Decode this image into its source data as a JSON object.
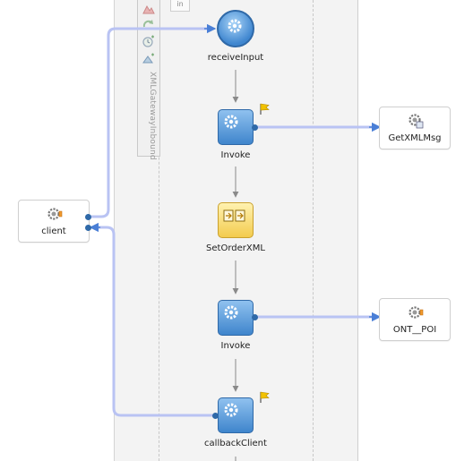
{
  "palette": {
    "label": "XMLGatewayInbound",
    "icons": [
      "validate-icon",
      "transform-icon",
      "wait-icon",
      "assign-icon"
    ]
  },
  "scope_tab": {
    "label": "in"
  },
  "activities": {
    "receive": {
      "label": "receiveInput",
      "icon": "gear-icon"
    },
    "invoke1": {
      "label": "Invoke",
      "icon": "gear-icon"
    },
    "setorder": {
      "label": "SetOrderXML",
      "icon": "assign-icon"
    },
    "invoke2": {
      "label": "Invoke",
      "icon": "gear-icon"
    },
    "callback": {
      "label": "callbackClient",
      "icon": "gear-icon"
    }
  },
  "partners": {
    "client": {
      "label": "client",
      "icon": "service-gear-icon"
    },
    "getxml": {
      "label": "GetXMLMsg",
      "icon": "service-gear-icon"
    },
    "ontpoi": {
      "label": "ONT__POI",
      "icon": "service-gear-icon"
    }
  },
  "colors": {
    "activity_blue": "#3f85cc",
    "activity_yellow": "#f3cc4e",
    "wire": "#b9c3f3",
    "flow_arrow": "#8a8a8a",
    "flag": "#f2c200"
  }
}
